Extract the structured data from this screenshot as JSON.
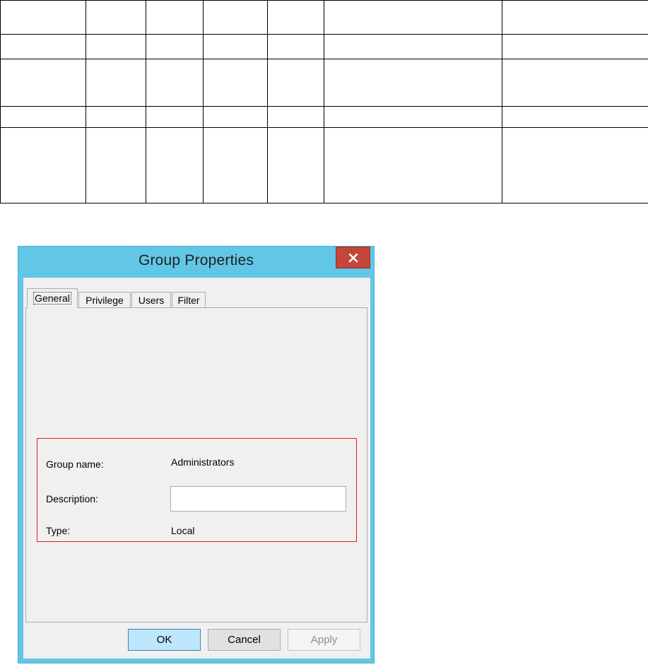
{
  "dialog": {
    "title": "Group Properties",
    "close_label": "x",
    "tabs": [
      {
        "label": "General",
        "active": true
      },
      {
        "label": "Privilege",
        "active": false
      },
      {
        "label": "Users",
        "active": false
      },
      {
        "label": "Filter",
        "active": false
      }
    ],
    "fields": {
      "group_name_label": "Group name:",
      "group_name_value": "Administrators",
      "description_label": "Description:",
      "description_value": "",
      "type_label": "Type:",
      "type_value": "Local"
    },
    "buttons": {
      "ok": "OK",
      "cancel": "Cancel",
      "apply": "Apply"
    }
  },
  "colors": {
    "title_bar": "#62c6e6",
    "close_button": "#c4463a",
    "highlight_border": "#e0201c",
    "ok_button": "#bee6fd"
  }
}
